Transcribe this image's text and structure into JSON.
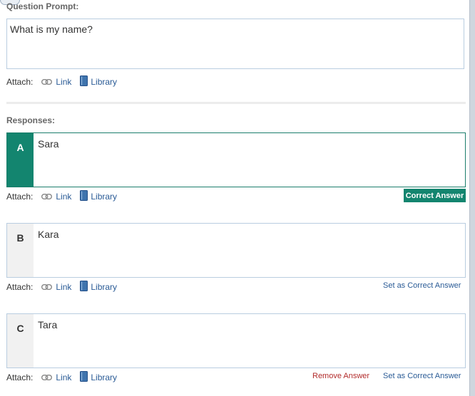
{
  "question": {
    "label": "Question Prompt:",
    "value": "What is my name?"
  },
  "attach": {
    "label": "Attach:",
    "link_label": "Link",
    "library_label": "Library"
  },
  "responses": {
    "label": "Responses:",
    "items": [
      {
        "letter": "A",
        "text": "Sara",
        "status": "Correct Answer"
      },
      {
        "letter": "B",
        "text": "Kara",
        "set_correct_label": "Set as Correct Answer"
      },
      {
        "letter": "C",
        "text": "Tara",
        "remove_label": "Remove Answer",
        "set_correct_label": "Set as Correct Answer"
      }
    ]
  },
  "colors": {
    "correct": "#13856f",
    "link": "#2a5b96",
    "remove": "#b22b2b"
  }
}
